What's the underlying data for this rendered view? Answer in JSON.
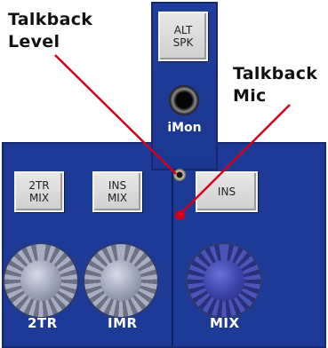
{
  "callouts": {
    "talkback_level": "Talkback\nLevel",
    "talkback_mic": "Talkback\n Mic"
  },
  "upper_panel": {
    "alt_spk_button": "ALT\nSPK",
    "imon_label": "iMon"
  },
  "buttons": {
    "two_tr_mix": "2TR\nMIX",
    "ins_mix": "INS\nMIX",
    "ins": "INS"
  },
  "knobs": {
    "two_tr": "2TR",
    "imr": "IMR",
    "mix": "MIX"
  },
  "colors": {
    "panel_blue": "#1d3a96",
    "callout_line": "#d4001a",
    "button_face": "#dcdcdc"
  }
}
